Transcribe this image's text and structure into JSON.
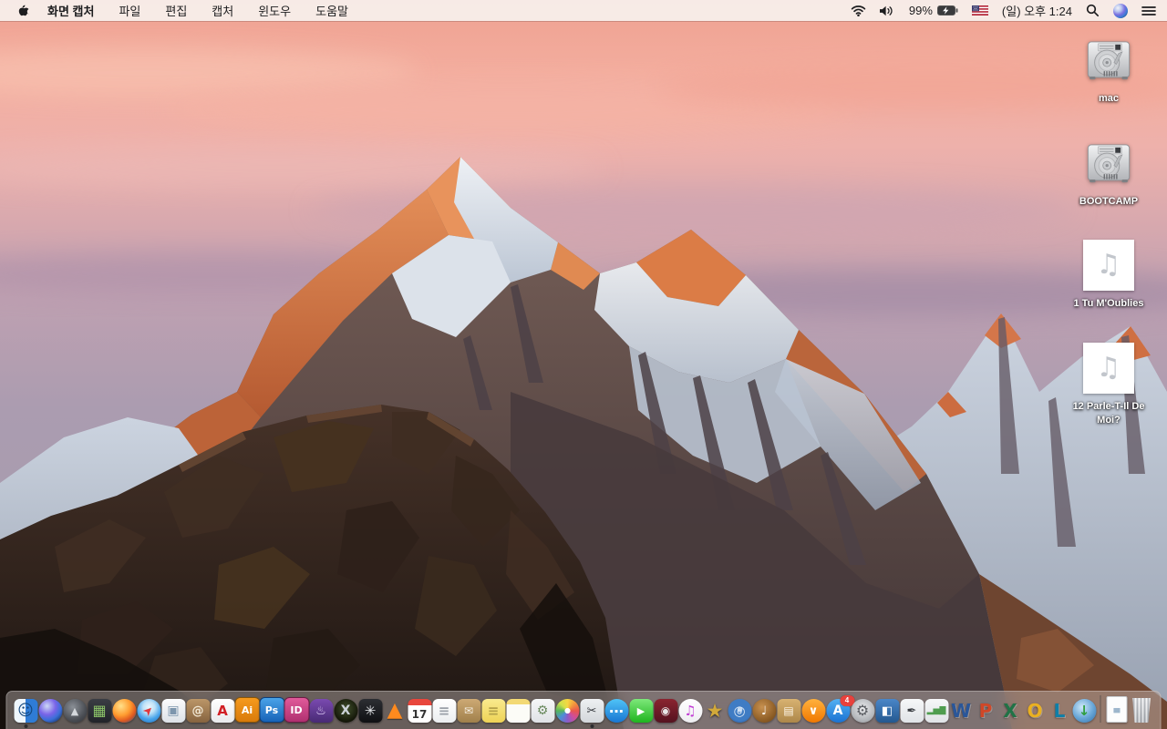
{
  "menu_bar": {
    "app_name": "화면 캡처",
    "menus": [
      {
        "name": "file",
        "label": "파일"
      },
      {
        "name": "edit",
        "label": "편집"
      },
      {
        "name": "capture",
        "label": "캡처"
      },
      {
        "name": "window",
        "label": "윈도우"
      },
      {
        "name": "help",
        "label": "도움말"
      }
    ],
    "battery_percent": "99%",
    "clock": "(일) 오후 1:24",
    "status_icons": [
      "wifi",
      "volume",
      "battery-charging",
      "us-flag",
      "spotlight-search",
      "siri",
      "notification-center"
    ]
  },
  "desktop_icons": [
    {
      "name": "volume-mac",
      "label": "mac",
      "type": "hard-drive"
    },
    {
      "name": "volume-bootcamp",
      "label": "BOOTCAMP",
      "type": "hard-drive"
    },
    {
      "name": "audio-file-1",
      "label": "1 Tu M'Oublies",
      "type": "audio-file",
      "glyph": "♫"
    },
    {
      "name": "audio-file-12",
      "label": "12 Parle-T-Il De Moi?",
      "type": "audio-file",
      "glyph": "♫"
    }
  ],
  "dock": {
    "items": [
      {
        "name": "finder",
        "glyph": "☺",
        "running": true
      },
      {
        "name": "siri",
        "glyph": ""
      },
      {
        "name": "launchpad",
        "glyph": "▲"
      },
      {
        "name": "mission-control",
        "glyph": "▦"
      },
      {
        "name": "firefox",
        "glyph": ""
      },
      {
        "name": "safari",
        "glyph": "➤"
      },
      {
        "name": "preview",
        "glyph": "▣"
      },
      {
        "name": "contacts",
        "glyph": "@"
      },
      {
        "name": "acrobat-reader",
        "glyph": "A"
      },
      {
        "name": "illustrator",
        "glyph": "Ai"
      },
      {
        "name": "photoshop",
        "glyph": "Ps"
      },
      {
        "name": "indesign",
        "glyph": "ID"
      },
      {
        "name": "toast",
        "glyph": "♨"
      },
      {
        "name": "x-app",
        "glyph": "X"
      },
      {
        "name": "fan-utility",
        "glyph": "✳"
      },
      {
        "name": "vlc",
        "glyph": "▲"
      },
      {
        "name": "calendar",
        "glyph": "17"
      },
      {
        "name": "reminders",
        "glyph": "≡"
      },
      {
        "name": "stuffit-expander",
        "glyph": "✉"
      },
      {
        "name": "stickies",
        "glyph": "≡"
      },
      {
        "name": "notes",
        "glyph": ""
      },
      {
        "name": "installer",
        "glyph": "⚙"
      },
      {
        "name": "photos",
        "glyph": ""
      },
      {
        "name": "grab",
        "glyph": "✂",
        "running": true
      },
      {
        "name": "messages",
        "glyph": "…"
      },
      {
        "name": "facetime",
        "glyph": "▶"
      },
      {
        "name": "photo-booth",
        "glyph": "◉"
      },
      {
        "name": "itunes",
        "glyph": "♫"
      },
      {
        "name": "imovie",
        "glyph": "★"
      },
      {
        "name": "dvd-player",
        "glyph": "◎"
      },
      {
        "name": "garageband",
        "glyph": "♩"
      },
      {
        "name": "documents-app",
        "glyph": "▤"
      },
      {
        "name": "ibooks",
        "glyph": "∨"
      },
      {
        "name": "app-store",
        "glyph": "A",
        "badge": "4"
      },
      {
        "name": "system-preferences",
        "glyph": "⚙"
      },
      {
        "name": "keynote",
        "glyph": "◧"
      },
      {
        "name": "pages",
        "glyph": "✒"
      },
      {
        "name": "numbers",
        "glyph": "▂▅▇"
      },
      {
        "name": "word",
        "glyph": "W"
      },
      {
        "name": "powerpoint",
        "glyph": "P"
      },
      {
        "name": "excel",
        "glyph": "X"
      },
      {
        "name": "outlook",
        "glyph": "O"
      },
      {
        "name": "lync",
        "glyph": "L"
      },
      {
        "name": "downloader",
        "glyph": "↓"
      },
      {
        "name": "separator",
        "kind": "separator"
      },
      {
        "name": "document-file",
        "glyph": "▄"
      },
      {
        "name": "trash",
        "glyph": ""
      }
    ]
  },
  "colors": {
    "menu_bar_bg": "#f8f0ed",
    "badge_red": "#e8413c",
    "sky_top": "#efa191",
    "sky_bottom": "#a29aab",
    "sunlit_rock": "#cf6f3e",
    "foreground_rock": "#271d19"
  }
}
